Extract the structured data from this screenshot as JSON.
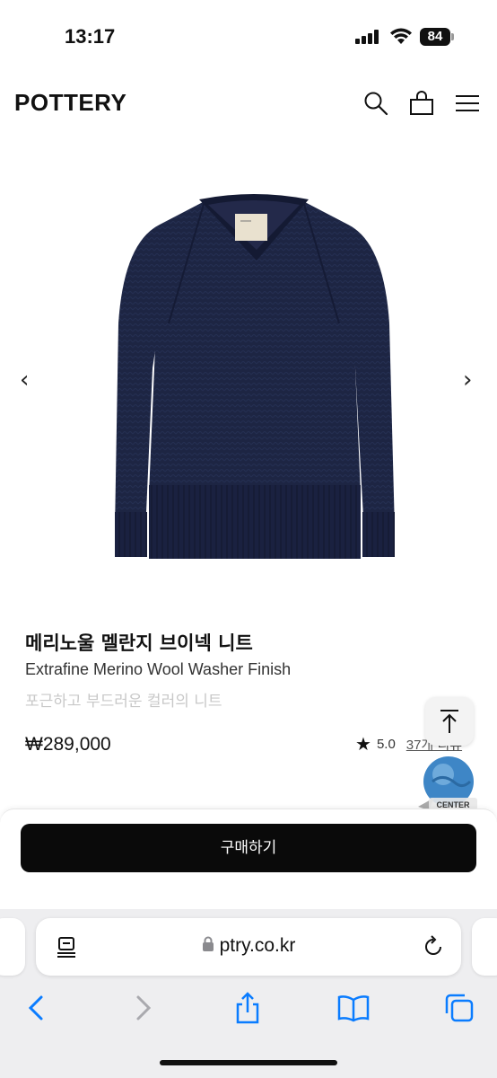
{
  "status": {
    "time": "13:17",
    "battery": "84"
  },
  "header": {
    "logo": "POTTERY"
  },
  "product": {
    "name_ko": "메리노울 멜란지 브이넥 니트",
    "name_en": "Extrafine Merino Wool Washer Finish",
    "description": "포근하고 부드러운 컬러의 니트",
    "price": "₩289,000",
    "rating": "5.0",
    "reviews": "37개 리뷰",
    "sweater_color": "#1b2340"
  },
  "gallery": {
    "prev": "‹",
    "next": "›"
  },
  "badge": {
    "label": "CENTER"
  },
  "buy": {
    "label": "구매하기"
  },
  "browser": {
    "url": "ptry.co.kr"
  },
  "colors": {
    "accent": "#0a0a0a",
    "link": "#0a7cff"
  }
}
